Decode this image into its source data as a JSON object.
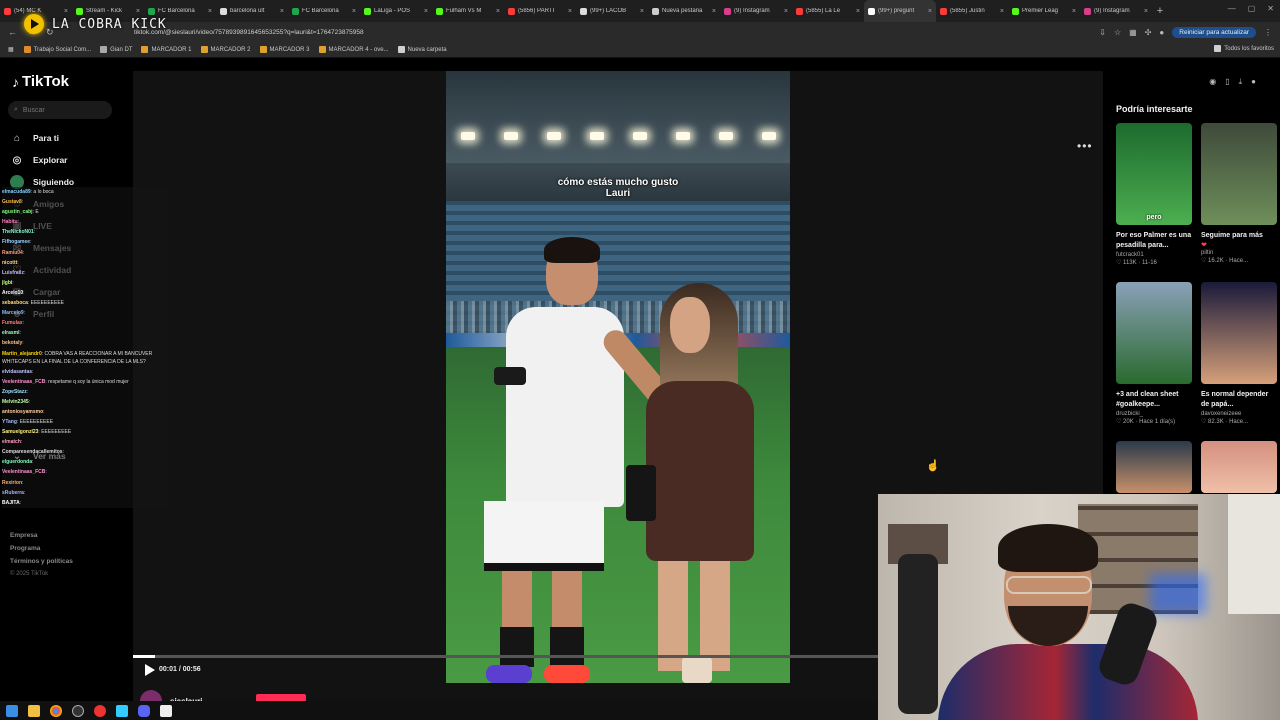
{
  "browser": {
    "tabs": [
      {
        "label": "(54) MC K",
        "color": "#ff3b3b"
      },
      {
        "label": "Stream - Kick",
        "color": "#53fc18"
      },
      {
        "label": "FC Barcelona",
        "color": "#1ca94c"
      },
      {
        "label": "barcelona ult",
        "color": "#dddddd"
      },
      {
        "label": "FC Barcelona",
        "color": "#1ca94c"
      },
      {
        "label": "LaLiga - POS",
        "color": "#53fc18"
      },
      {
        "label": "Fulham Vs M",
        "color": "#53fc18"
      },
      {
        "label": "(5856) PARTI",
        "color": "#ff3b3b"
      },
      {
        "label": "(99+) LACOB",
        "color": "#dddddd"
      },
      {
        "label": "Nueva pestaña",
        "color": "#cccccc"
      },
      {
        "label": "(9) Instagram",
        "color": "#d93d8c"
      },
      {
        "label": "(5855) La Le",
        "color": "#ff3b3b"
      },
      {
        "label": "(99+) pregunt",
        "color": "#ffffff",
        "active": true
      },
      {
        "label": "(5855) Justin",
        "color": "#ff3b3b"
      },
      {
        "label": "Premier Leag",
        "color": "#53fc18"
      },
      {
        "label": "(9) Instagram",
        "color": "#d93d8c"
      }
    ],
    "url": "tiktok.com/@sieslauri/video/7578939891645653255?q=lauri&t=1764723875958",
    "update_label": "Reiniciar para actualizar",
    "bookmarks": [
      {
        "label": "Trabajo Social Com...",
        "color": "#e08a2c"
      },
      {
        "label": "Gian DT",
        "color": "#aaaaaa"
      },
      {
        "label": "MARCADOR 1",
        "color": "#e0a030"
      },
      {
        "label": "MARCADOR 2",
        "color": "#e0a030"
      },
      {
        "label": "MARCADOR 3",
        "color": "#e0a030"
      },
      {
        "label": "MARCADOR 4 - ove...",
        "color": "#e0a030"
      },
      {
        "label": "Nueva carpeta",
        "color": "#cfcfcf"
      }
    ],
    "all_bookmarks_label": "Todos los favoritos"
  },
  "stream": {
    "name": "LA COBRA KICK"
  },
  "tiktok": {
    "logo": "TikTok",
    "search_placeholder": "Buscar",
    "nav": [
      {
        "label": "Para ti",
        "icon": "home-icon",
        "glyph": "⌂"
      },
      {
        "label": "Explorar",
        "icon": "compass-icon",
        "glyph": "◎"
      },
      {
        "label": "Siguiendo",
        "icon": "following-icon",
        "glyph": ""
      },
      {
        "label": "Amigos",
        "icon": "friends-icon",
        "glyph": "☺"
      },
      {
        "label": "LIVE",
        "icon": "live-icon",
        "glyph": "▣"
      },
      {
        "label": "Mensajes",
        "icon": "messages-icon",
        "glyph": "✉"
      },
      {
        "label": "Actividad",
        "icon": "activity-icon",
        "glyph": "♡"
      },
      {
        "label": "Cargar",
        "icon": "upload-icon",
        "glyph": "⊞"
      },
      {
        "label": "Perfil",
        "icon": "profile-icon",
        "glyph": "☻"
      }
    ],
    "more_label": "Ver más",
    "footer": {
      "company": "Empresa",
      "program": "Programa",
      "terms": "Términos y políticas",
      "copyright": "© 2025 TikTok"
    },
    "video": {
      "caption_line1": "cómo estás mucho gusto",
      "caption_line2": "Lauri",
      "time": "00:01 / 00:56",
      "progress": 0.03,
      "author": "sieslauri"
    },
    "suggestions_title": "Podría interesarte",
    "suggestions": [
      {
        "title": "Por eso Palmer es una pesadilla para...",
        "author": "futcrack01",
        "likes": "113K",
        "date": "11-16",
        "overlay": "pero",
        "colors": [
          "#1d6a2e",
          "#4caf50"
        ]
      },
      {
        "title": "Seguime para más",
        "author": "piltin",
        "likes": "16.2K",
        "date": "Hace...",
        "overlay": "",
        "colors": [
          "#3e4a3a",
          "#6f8f5a"
        ],
        "heart": "❤"
      },
      {
        "title": "+3 and clean sheet #goalkeepe...",
        "author": "druzbicki_",
        "likes": "20K",
        "date": "Hace 1 día(s)",
        "overlay": "",
        "colors": [
          "#8aa0b8",
          "#2a6a2e"
        ]
      },
      {
        "title": "Es normal depender de papá...",
        "author": "davoxeneizeee",
        "likes": "82.3K",
        "date": "Hace...",
        "overlay": "",
        "colors": [
          "#1a1a3a",
          "#d6a07a"
        ]
      },
      {
        "title": "",
        "author": "",
        "likes": "",
        "date": "",
        "overlay": "",
        "colors": [
          "#2a3a4a",
          "#c8906a"
        ]
      },
      {
        "title": "",
        "author": "",
        "likes": "",
        "date": "",
        "overlay": "",
        "colors": [
          "#d49080",
          "#f0c0a8"
        ]
      }
    ]
  },
  "chat": [
    {
      "user": "elmacuda89",
      "text": "a lo boca",
      "color": "#7fd1ff"
    },
    {
      "user": "Gustav8",
      "text": "",
      "color": "#ffb84d"
    },
    {
      "user": "agustin_cabj",
      "text": "E",
      "color": "#7fff7f"
    },
    {
      "user": "Habitu",
      "text": "",
      "color": "#ff7fbf"
    },
    {
      "user": "TheNickoN01",
      "text": "",
      "color": "#7fffd4"
    },
    {
      "user": "Fifhogamee",
      "text": "",
      "color": "#9ad0ff"
    },
    {
      "user": "Ramiu04",
      "text": "",
      "color": "#ff9f7f"
    },
    {
      "user": "nicottt",
      "text": "",
      "color": "#ffd27f"
    },
    {
      "user": "Luisfrailz",
      "text": "",
      "color": "#bfbfff"
    },
    {
      "user": "jlgbi",
      "text": "",
      "color": "#c0ff7f"
    },
    {
      "user": "Arcelo10",
      "text": "",
      "color": "#ffffff"
    },
    {
      "user": "sebasboca",
      "text": "EEEEEEEEEE",
      "color": "#ffdf7f"
    },
    {
      "user": "Marcelo9",
      "text": "",
      "color": "#7fbfff"
    },
    {
      "user": "Fumulax",
      "text": "",
      "color": "#ff7f7f"
    },
    {
      "user": "elrasml",
      "text": "",
      "color": "#9fffbf"
    },
    {
      "user": "bekotaly",
      "text": "",
      "color": "#ffbf7f"
    },
    {
      "user": "Martin_alejandr0",
      "text": "COBRA VAS A REACCIONAR A MI BANCUVER WHITECAPS EN LA FINAL DE LA CONFERENCIA DE LA MLS?",
      "color": "#ffd400",
      "wrap": true
    },
    {
      "user": "elvidasantas",
      "text": "",
      "color": "#c0c0ff"
    },
    {
      "user": "Veelentinaas_FCB",
      "text": "respetame q soy la única mod mujer",
      "color": "#ff8fd0"
    },
    {
      "user": "ZopeStazz",
      "text": "",
      "color": "#9fdfff"
    },
    {
      "user": "Melvin2345",
      "text": "",
      "color": "#bfff9f"
    },
    {
      "user": "antoniosyamsmo",
      "text": "",
      "color": "#ffcf9f"
    },
    {
      "user": "YTang",
      "text": "EEEEEEEEEE",
      "color": "#9fbfff"
    },
    {
      "user": "Samuelgonzl23",
      "text": "EEEEEEEEE",
      "color": "#ffef7f"
    },
    {
      "user": "elmatch",
      "text": "",
      "color": "#ff9fbf"
    },
    {
      "user": "Comparesendacallemitos",
      "text": "",
      "color": "#dfdfdf"
    },
    {
      "user": "elguerdonda",
      "text": "",
      "color": "#7fffbf"
    },
    {
      "user": "Veelentinaas_FCB",
      "text": "",
      "color": "#ff8fd0"
    },
    {
      "user": "Rexirion",
      "text": "",
      "color": "#ffaf6f"
    },
    {
      "user": "sRuberra",
      "text": "",
      "color": "#afafff"
    },
    {
      "user": "BAJITA",
      "text": "",
      "color": "#ffffff"
    }
  ]
}
